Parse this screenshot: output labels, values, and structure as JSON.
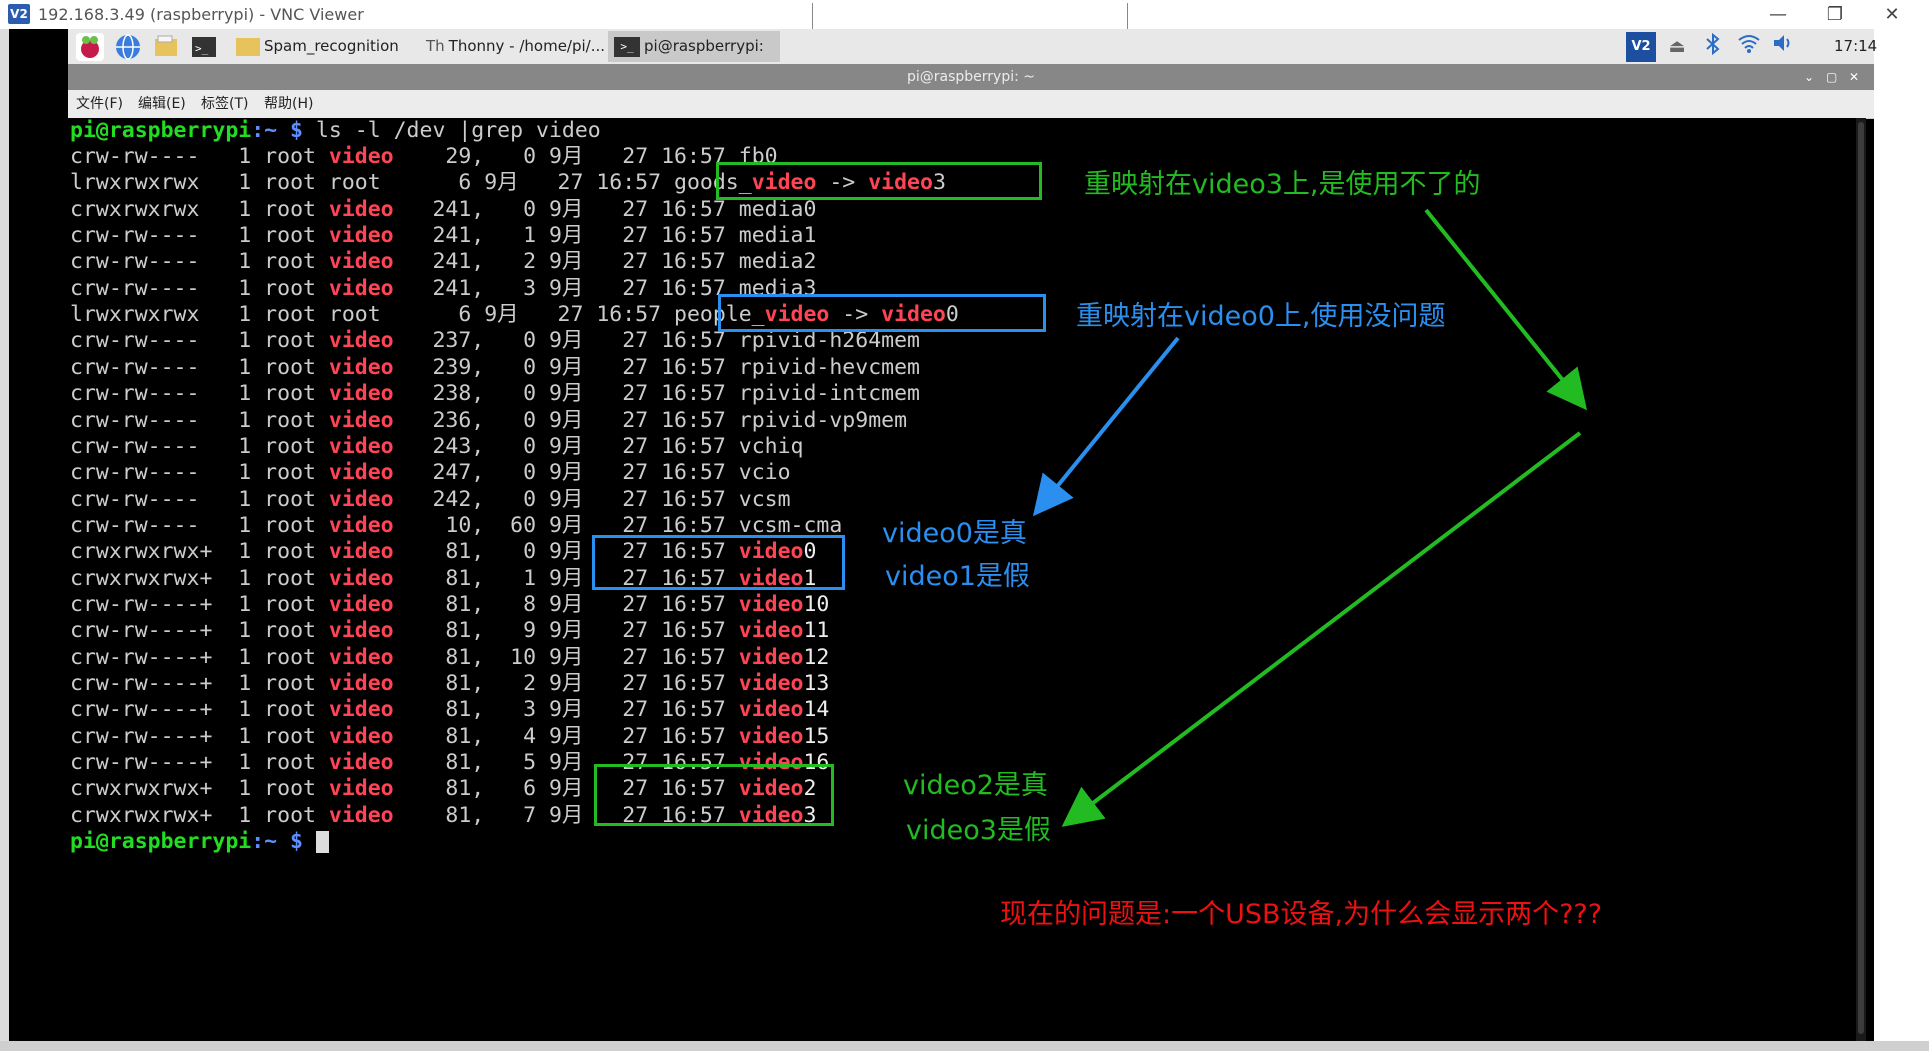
{
  "vnc": {
    "title": "192.168.3.49 (raspberrypi) - VNC Viewer",
    "logo": "V2",
    "minimize": "—",
    "restore": "❐",
    "close": "✕"
  },
  "taskbar": {
    "apps": [
      {
        "icon": "raspberry-menu-icon"
      },
      {
        "icon": "web-browser-icon"
      },
      {
        "icon": "file-manager-icon"
      },
      {
        "icon": "terminal-launcher-icon"
      }
    ],
    "windows": [
      {
        "label": "Spam_recognition",
        "icon": "folder-icon"
      },
      {
        "label": "Thonny  -  /home/pi/...",
        "icon": "thonny-icon"
      },
      {
        "label": "pi@raspberrypi: ~",
        "icon": "terminal-icon"
      }
    ],
    "tray": {
      "vnc": "V2",
      "clock": "17:14",
      "icons": [
        "vnc-server-icon",
        "eject-icon",
        "bluetooth-icon",
        "wifi-icon",
        "volume-icon"
      ]
    }
  },
  "terminal": {
    "title": "pi@raspberrypi: ~",
    "controls": [
      "⌄",
      "▢",
      "✕"
    ],
    "menu": [
      "文件(F)",
      "编辑(E)",
      "标签(T)",
      "帮助(H)"
    ],
    "prompt_user": "pi@raspberrypi",
    "prompt_path": ":~ $ ",
    "command": "ls -l /dev |grep video",
    "rows": [
      [
        "crw-rw----  ",
        " 1 root ",
        "video",
        "    29,   0 9月   27 16:57 ",
        "fb0",
        ""
      ],
      [
        "lrwxrwxrwx  ",
        " 1 root ",
        "root",
        "      6 9月   27 16:57 ",
        "goods_video -> video3",
        "link"
      ],
      [
        "crwxrwxrwx  ",
        " 1 root ",
        "video",
        "   241,   0 9月   27 16:57 ",
        "media0",
        ""
      ],
      [
        "crw-rw----  ",
        " 1 root ",
        "video",
        "   241,   1 9月   27 16:57 ",
        "media1",
        ""
      ],
      [
        "crw-rw----  ",
        " 1 root ",
        "video",
        "   241,   2 9月   27 16:57 ",
        "media2",
        ""
      ],
      [
        "crw-rw----  ",
        " 1 root ",
        "video",
        "   241,   3 9月   27 16:57 ",
        "media3",
        ""
      ],
      [
        "lrwxrwxrwx  ",
        " 1 root ",
        "root",
        "      6 9月   27 16:57 ",
        "people_video -> video0",
        "link"
      ],
      [
        "crw-rw----  ",
        " 1 root ",
        "video",
        "   237,   0 9月   27 16:57 ",
        "rpivid-h264mem",
        ""
      ],
      [
        "crw-rw----  ",
        " 1 root ",
        "video",
        "   239,   0 9月   27 16:57 ",
        "rpivid-hevcmem",
        ""
      ],
      [
        "crw-rw----  ",
        " 1 root ",
        "video",
        "   238,   0 9月   27 16:57 ",
        "rpivid-intcmem",
        ""
      ],
      [
        "crw-rw----  ",
        " 1 root ",
        "video",
        "   236,   0 9月   27 16:57 ",
        "rpivid-vp9mem",
        ""
      ],
      [
        "crw-rw----  ",
        " 1 root ",
        "video",
        "   243,   0 9月   27 16:57 ",
        "vchiq",
        ""
      ],
      [
        "crw-rw----  ",
        " 1 root ",
        "video",
        "   247,   0 9月   27 16:57 ",
        "vcio",
        ""
      ],
      [
        "crw-rw----  ",
        " 1 root ",
        "video",
        "   242,   0 9月   27 16:57 ",
        "vcsm",
        ""
      ],
      [
        "crw-rw----  ",
        " 1 root ",
        "video",
        "    10,  60 9月   27 16:57 ",
        "vcsm-cma",
        ""
      ],
      [
        "crwxrwxrwx+ ",
        " 1 root ",
        "video",
        "    81,   0 9月   27 16:57 ",
        "video0",
        "video"
      ],
      [
        "crwxrwxrwx+ ",
        " 1 root ",
        "video",
        "    81,   1 9月   27 16:57 ",
        "video1",
        "video"
      ],
      [
        "crw-rw----+ ",
        " 1 root ",
        "video",
        "    81,   8 9月   27 16:57 ",
        "video10",
        "video"
      ],
      [
        "crw-rw----+ ",
        " 1 root ",
        "video",
        "    81,   9 9月   27 16:57 ",
        "video11",
        "video"
      ],
      [
        "crw-rw----+ ",
        " 1 root ",
        "video",
        "    81,  10 9月   27 16:57 ",
        "video12",
        "video"
      ],
      [
        "crw-rw----+ ",
        " 1 root ",
        "video",
        "    81,   2 9月   27 16:57 ",
        "video13",
        "video"
      ],
      [
        "crw-rw----+ ",
        " 1 root ",
        "video",
        "    81,   3 9月   27 16:57 ",
        "video14",
        "video"
      ],
      [
        "crw-rw----+ ",
        " 1 root ",
        "video",
        "    81,   4 9月   27 16:57 ",
        "video15",
        "video"
      ],
      [
        "crw-rw----+ ",
        " 1 root ",
        "video",
        "    81,   5 9月   27 16:57 ",
        "video16",
        "video"
      ],
      [
        "crwxrwxrwx+ ",
        " 1 root ",
        "video",
        "    81,   6 9月   27 16:57 ",
        "video2",
        "video"
      ],
      [
        "crwxrwxrwx+ ",
        " 1 root ",
        "video",
        "    81,   7 9月   27 16:57 ",
        "video3",
        "video"
      ]
    ]
  },
  "annotations": {
    "goods_note": "重映射在video3上,是使用不了的",
    "people_note": "重映射在video0上,使用没问题",
    "pair1_line1": "video0是真",
    "pair1_line2": "video1是假",
    "pair2_line1": "video2是真",
    "pair2_line2": "video3是假",
    "question": "现在的问题是:一个USB设备,为什么会显示两个???",
    "colors": {
      "green": "#22bb22",
      "blue": "#2b8ff0",
      "red": "#ee1111"
    }
  }
}
